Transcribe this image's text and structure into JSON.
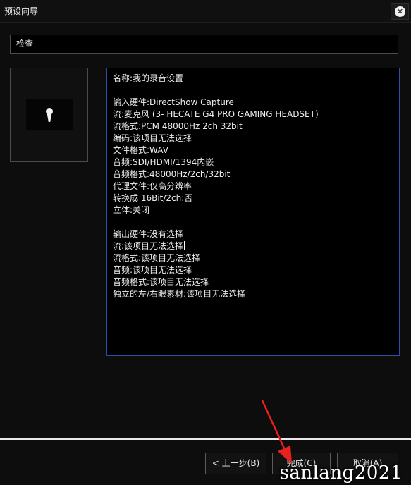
{
  "window": {
    "title": "预设向导",
    "close_icon": "close-circle-icon",
    "close_glyph": "✕"
  },
  "step_label": "检查",
  "preset_icon": "microphone-icon",
  "summary": {
    "lines": [
      "名称:我的录音设置",
      "",
      "输入硬件:DirectShow Capture",
      "流:麦克风 (3- HECATE G4 PRO GAMING HEADSET)",
      "流格式:PCM 48000Hz 2ch 32bit",
      "编码:该项目无法选择",
      "文件格式:WAV",
      "音频:SDI/HDMI/1394内嵌",
      "音频格式:48000Hz/2ch/32bit",
      "代理文件:仅高分辨率",
      "转换成 16Bit/2ch:否",
      "立体:关闭",
      "",
      "输出硬件:没有选择",
      "流:该项目无法选择",
      "流格式:该项目无法选择",
      "音频:该项目无法选择",
      "音频格式:该项目无法选择",
      "独立的左/右眼素材:该项目无法选择"
    ]
  },
  "buttons": {
    "back": "< 上一步(B)",
    "finish": "完成(C)",
    "cancel": "取消(A)"
  },
  "watermark": "sanlang2021",
  "colors": {
    "accent_border": "#2c4ea6",
    "arrow": "#e8201e"
  }
}
